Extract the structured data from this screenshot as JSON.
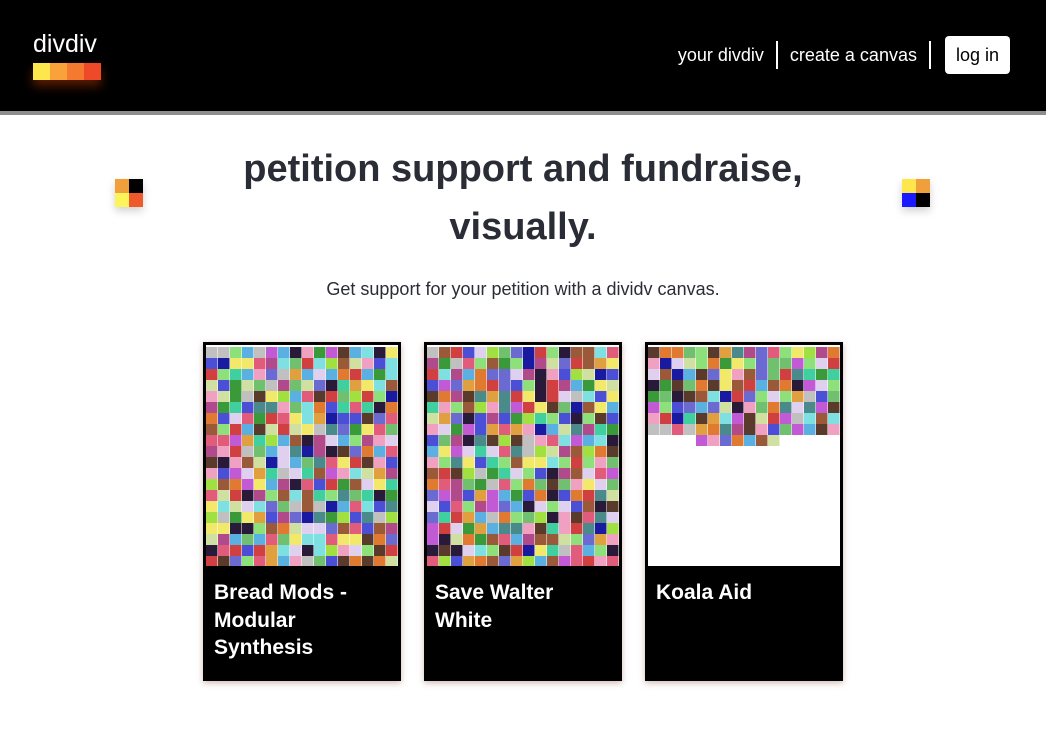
{
  "header": {
    "logo_text": "divdiv",
    "logo_colors": [
      "#fde74c",
      "#f9a13a",
      "#f57a2f",
      "#ee4a2a"
    ],
    "nav": {
      "your_divdiv": "your divdiv",
      "create_canvas": "create a canvas",
      "login": "log in"
    }
  },
  "hero": {
    "title_line1": "petition support and fundraise,",
    "title_line2": "visually.",
    "subtitle": "Get support for your petition with a dividv canvas.",
    "deco_left_colors": [
      "#f0a03a",
      "#000000",
      "#fdf35a",
      "#ee5a2a"
    ],
    "deco_right_colors": [
      "#fde74c",
      "#f0a03a",
      "#1a1aff",
      "#000000"
    ]
  },
  "cards": [
    {
      "title": "Bread Mods - Modular Synthesis",
      "fill_fraction": 1.0
    },
    {
      "title": "Save Walter White",
      "fill_fraction": 1.0
    },
    {
      "title": "Koala Aid",
      "fill_fraction": 0.42
    }
  ],
  "palette": [
    "#e05c7a",
    "#8de07a",
    "#4a4fd6",
    "#c25ad6",
    "#7ee0e0",
    "#3a9a3a",
    "#e0a040",
    "#f2e86a",
    "#9a5a3a",
    "#5ab0e0",
    "#d04040",
    "#e0d0f0",
    "#2a1a3a",
    "#a0e040",
    "#6a6ad0",
    "#f0a0c0",
    "#4a8a8a",
    "#d0e0a0",
    "#1a1aa0",
    "#e07a30",
    "#70c070",
    "#b04a8a",
    "#c0c0c0",
    "#5a3a2a",
    "#40d0a0"
  ]
}
